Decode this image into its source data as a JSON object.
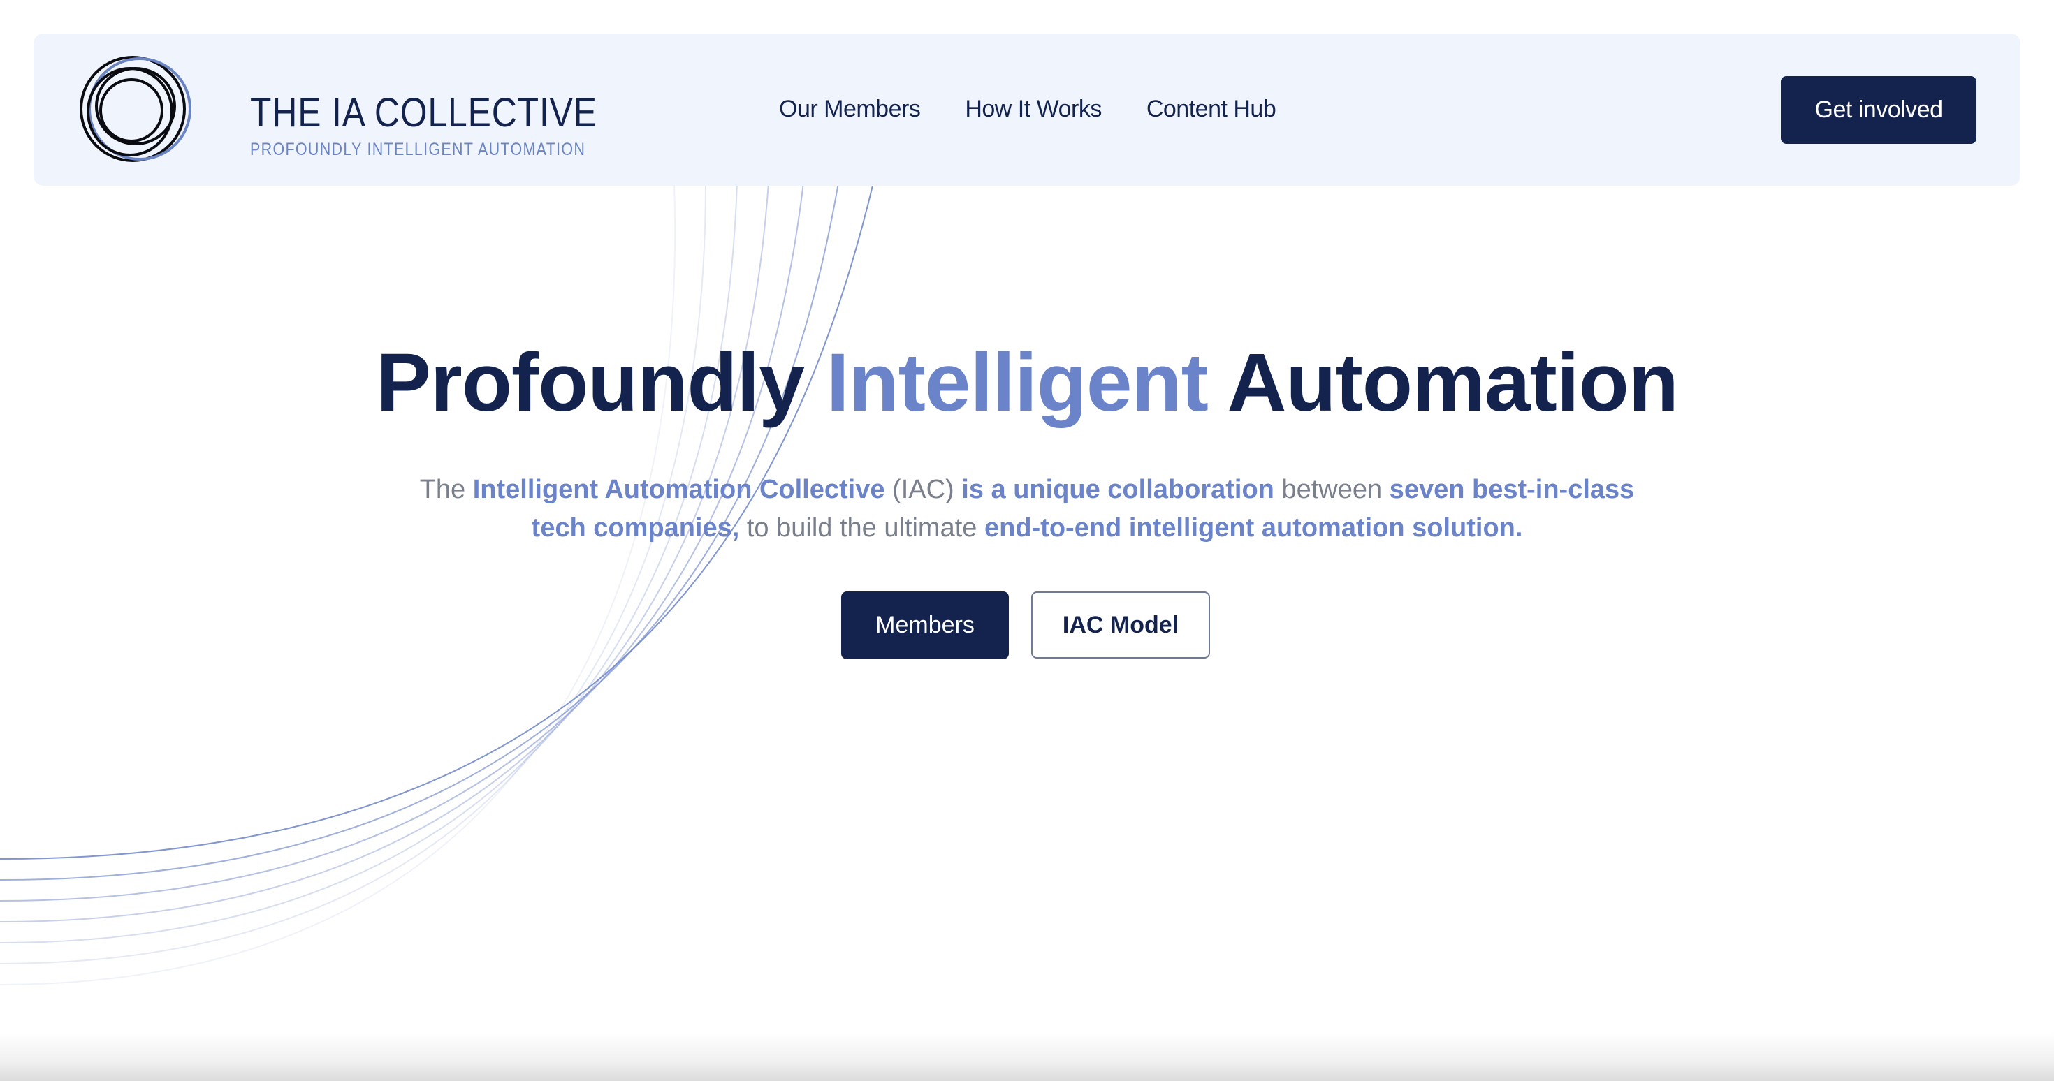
{
  "brand": {
    "title": "THE IA COLLECTIVE",
    "tagline": "PROFOUNDLY INTELLIGENT AUTOMATION",
    "icon": "concentric-circles-logo-icon"
  },
  "nav": {
    "items": [
      {
        "label": "Our Members"
      },
      {
        "label": "How It Works"
      },
      {
        "label": "Content Hub"
      }
    ],
    "cta_label": "Get involved"
  },
  "hero": {
    "title_part1": "Profoundly ",
    "title_accent": "Intelligent",
    "title_part2": " Automation",
    "subtitle": {
      "t1": "The ",
      "h1": "Intelligent Automation Collective",
      "t2": " (IAC) ",
      "h2": "is a unique collaboration",
      "t3": " between ",
      "h3": "seven best-in-class tech companies,",
      "t4": " to build the ultimate ",
      "h4": "end-to-end intelligent automation solution."
    },
    "buttons": {
      "members_label": "Members",
      "model_label": "IAC Model"
    }
  },
  "colors": {
    "navy": "#13234e",
    "accent": "#6b84c9",
    "header_bg": "#eff4fd",
    "body_text": "#7a7f8c"
  }
}
